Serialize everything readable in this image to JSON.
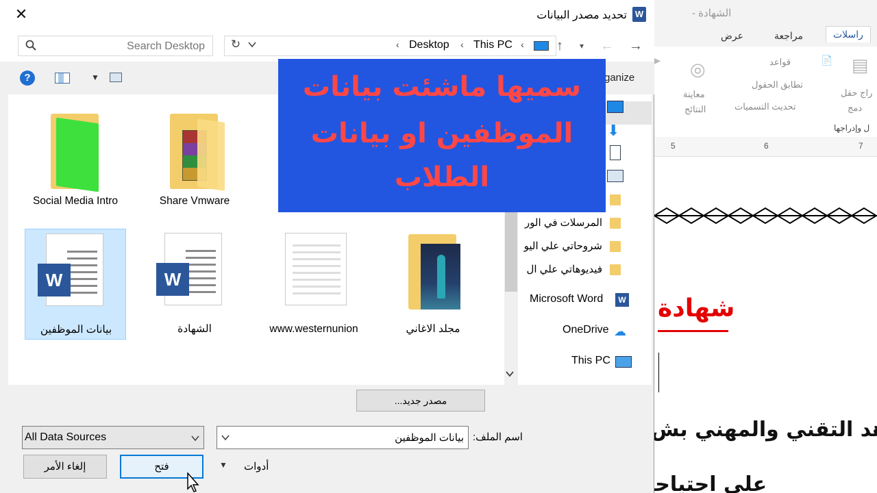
{
  "dialog": {
    "title": "تحديد مصدر البيانات",
    "title_icon": "W",
    "close": "✕"
  },
  "navbar": {
    "breadcrumb": [
      "This PC",
      "Desktop"
    ],
    "search_placeholder": "Search Desktop"
  },
  "toolbar": {
    "organize": "ganize"
  },
  "files": [
    {
      "label": "Social Media Intro",
      "kind": "folder-green"
    },
    {
      "label": "Share Vmware",
      "kind": "folder-rar"
    },
    {
      "label": "بيانات الموظفين",
      "kind": "word-doc",
      "selected": true
    },
    {
      "label": "الشهادة",
      "kind": "word-doc"
    },
    {
      "label": "www.westernunion",
      "kind": "text-doc"
    },
    {
      "label": "مجلد الاغاني",
      "kind": "folder-image"
    }
  ],
  "navpane": {
    "folders": [
      "المرسلات في الور",
      "شروحاتي علي اليو",
      "فيديوهاتي علي ال"
    ],
    "locations": [
      "Microsoft Word",
      "OneDrive",
      "This PC"
    ]
  },
  "bottom": {
    "new_source": "مصدر جديد...",
    "filename_label": "اسم الملف:",
    "filename_value": "بيانات الموظفين",
    "filetype_value": "All Data Sources",
    "tools_label": "أدوات",
    "open_label": "فتح",
    "cancel_label": "إلغاء الأمر"
  },
  "overlay": {
    "lines": [
      "سميها ماشئت بيانات",
      "الموظفين او بيانات",
      "الطلاب"
    ]
  },
  "word": {
    "title": "الشهادة -",
    "tabs": [
      "عرض",
      "مراجعة",
      "راسلات"
    ],
    "ribbon": {
      "preview_1": "معاينة",
      "preview_2": "النتائج",
      "rules": "قواعد",
      "match_fields": "تطابق الحقول",
      "update_labels": "تحديث التسميات",
      "insert_field_1": "راج حقل",
      "insert_field_2": "دمج",
      "group_label": "ل وإدراجها"
    },
    "ruler_numbers": [
      "5",
      "6",
      "7"
    ],
    "doc_heading": "شهادة",
    "doc_line1": "هد التقني والمهني بش",
    "doc_line2": "علي احتياجا"
  },
  "colors": {
    "overlay_bg": "#2256e0",
    "overlay_text": "#ff4747",
    "selection": "#cce8ff",
    "word_blue": "#2b579a",
    "heading_red": "#e30000"
  }
}
